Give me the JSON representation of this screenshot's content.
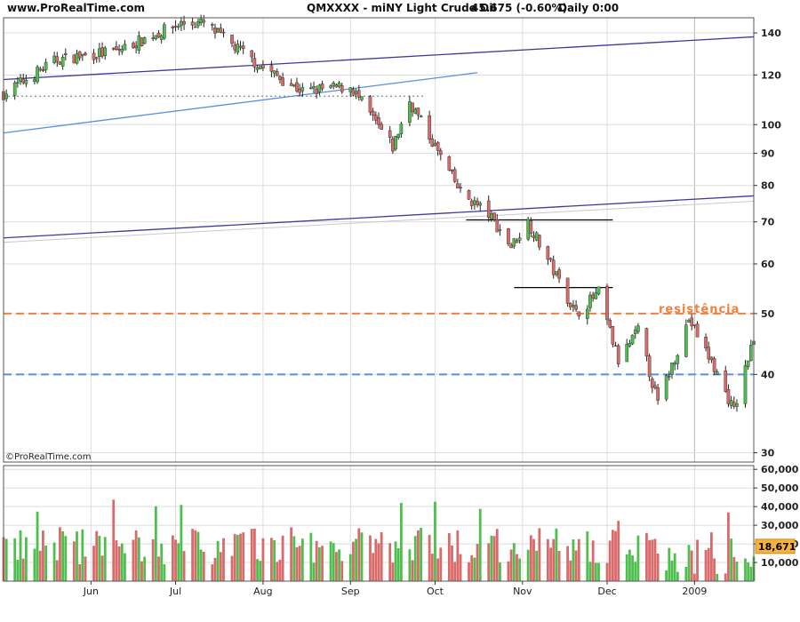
{
  "header": {
    "site": "www.ProRealTime.com",
    "symbol": "QMXXXX - miNY Light Crude Oil",
    "price": "45.675 (-0.60%)",
    "period": "Daily  0:00"
  },
  "footer": {
    "copyright": "©ProRealTime.com"
  },
  "colors": {
    "up": "#4cbf4c",
    "down": "#d96a6a",
    "trendline_dark": "#3b3b9e",
    "trendline_light": "#5a8ee0",
    "resistance": "#f0803c",
    "support": "#5a8ee0",
    "grid": "#dcdcdc"
  },
  "chart_data": [
    {
      "type": "candlestick",
      "title": "miNY Light Crude Oil",
      "y_scale": "log",
      "ylim": [
        29,
        148
      ],
      "y_ticks": [
        30,
        40,
        50,
        60,
        70,
        80,
        90,
        100,
        120,
        140
      ],
      "x_ticks": [
        "Jun",
        "Jul",
        "Aug",
        "Sep",
        "Oct",
        "Nov",
        "Dec",
        "2009"
      ],
      "x_range": [
        "2008-05-01",
        "2009-01-22"
      ],
      "last_value": 45.675,
      "annotations": [
        {
          "text": "resistência",
          "level": 50,
          "style": "dashed",
          "color": "#f0803c"
        },
        {
          "text": "",
          "level": 40,
          "style": "dashed",
          "color": "#5a8ee0"
        },
        {
          "text": "",
          "level": 111,
          "style": "dotted",
          "color": "#888888",
          "from": "2008-05-01",
          "to": "2008-09-27"
        },
        {
          "text": "",
          "level": 70.5,
          "style": "solid",
          "color": "#000000",
          "from": "2008-10-12",
          "to": "2008-12-03"
        },
        {
          "text": "",
          "level": 55,
          "style": "solid",
          "color": "#000000",
          "from": "2008-10-29",
          "to": "2008-12-03"
        }
      ],
      "trendlines": [
        {
          "from": [
            "2008-05-01",
            118
          ],
          "to": [
            "2009-01-22",
            138
          ],
          "color": "#3b3b9e"
        },
        {
          "from": [
            "2008-05-01",
            97
          ],
          "to": [
            "2008-10-16",
            121
          ],
          "color": "#5a8ee0"
        },
        {
          "from": [
            "2008-05-01",
            66
          ],
          "to": [
            "2009-01-22",
            77
          ],
          "color": "#3b3b9e"
        }
      ],
      "key_prices": [
        {
          "date": "2008-05-01",
          "close": 112
        },
        {
          "date": "2008-05-20",
          "close": 127
        },
        {
          "date": "2008-06-10",
          "close": 131
        },
        {
          "date": "2008-07-03",
          "close": 145
        },
        {
          "date": "2008-07-11",
          "close": 145
        },
        {
          "date": "2008-07-31",
          "close": 124
        },
        {
          "date": "2008-08-15",
          "close": 113
        },
        {
          "date": "2008-09-01",
          "close": 115
        },
        {
          "date": "2008-09-16",
          "close": 92
        },
        {
          "date": "2008-09-22",
          "close": 109
        },
        {
          "date": "2008-10-10",
          "close": 78
        },
        {
          "date": "2008-10-20",
          "close": 72
        },
        {
          "date": "2008-10-28",
          "close": 64
        },
        {
          "date": "2008-11-03",
          "close": 70
        },
        {
          "date": "2008-11-20",
          "close": 50
        },
        {
          "date": "2008-11-28",
          "close": 54
        },
        {
          "date": "2008-12-05",
          "close": 42
        },
        {
          "date": "2008-12-12",
          "close": 47
        },
        {
          "date": "2008-12-19",
          "close": 36
        },
        {
          "date": "2008-12-30",
          "close": 49
        },
        {
          "date": "2009-01-08",
          "close": 41
        },
        {
          "date": "2009-01-15",
          "close": 35
        },
        {
          "date": "2009-01-22",
          "close": 45.675
        }
      ]
    },
    {
      "type": "bar",
      "title": "Volume",
      "ylim": [
        0,
        62000
      ],
      "y_ticks": [
        10000,
        20000,
        30000,
        40000,
        50000,
        60000
      ],
      "y_tick_labels": [
        "10,000",
        "20,000",
        "30,000",
        "40,000",
        "50,000",
        "60,000"
      ],
      "last_value": 18671,
      "last_value_label": "18,671"
    }
  ]
}
